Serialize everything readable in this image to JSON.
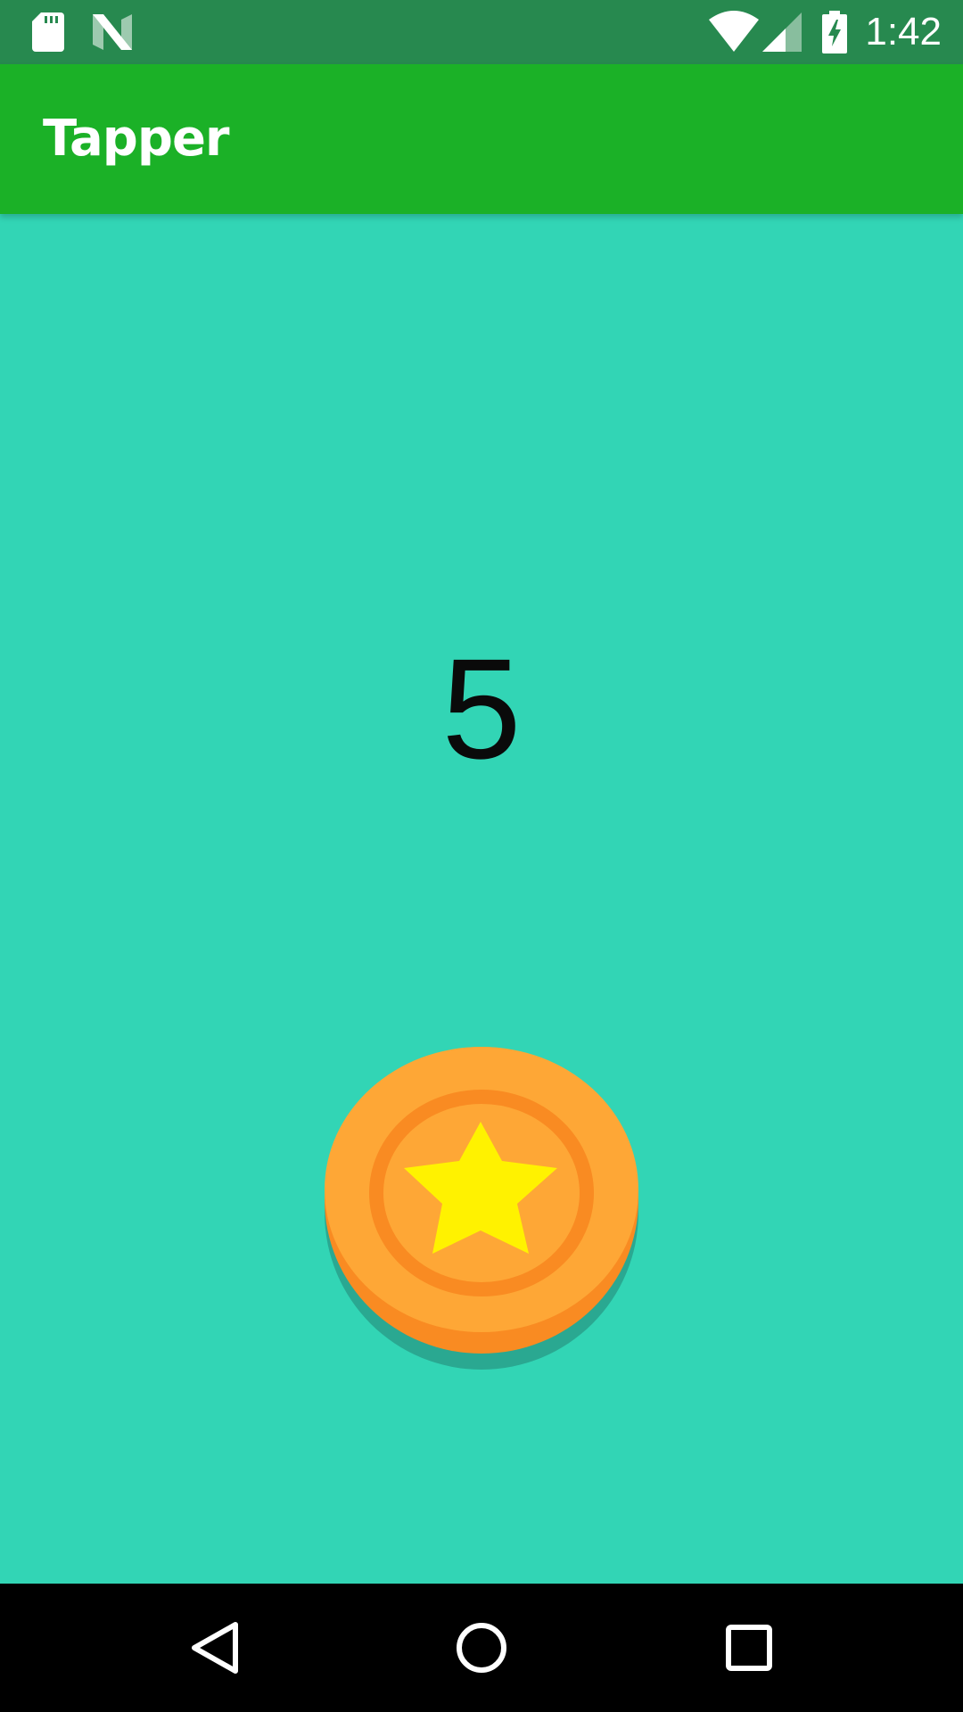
{
  "status_bar": {
    "time": "1:42",
    "icons": [
      "sd-card-icon",
      "n-logo-icon",
      "wifi-icon",
      "cell-signal-icon",
      "battery-charging-icon"
    ]
  },
  "app_bar": {
    "title": "Tapper"
  },
  "main": {
    "tap_count": "5",
    "coin_icon": "star-coin-icon"
  },
  "nav_bar": {
    "icons": [
      "back-icon",
      "home-icon",
      "recents-icon"
    ]
  },
  "colors": {
    "status_bar": "#27894f",
    "app_bar": "#1bb127",
    "background": "#32d5b5",
    "coin_face": "#fea736",
    "coin_ring": "#f98b22",
    "coin_shadow": "#2aa891",
    "star": "#fff200",
    "nav_bar": "#000000"
  }
}
